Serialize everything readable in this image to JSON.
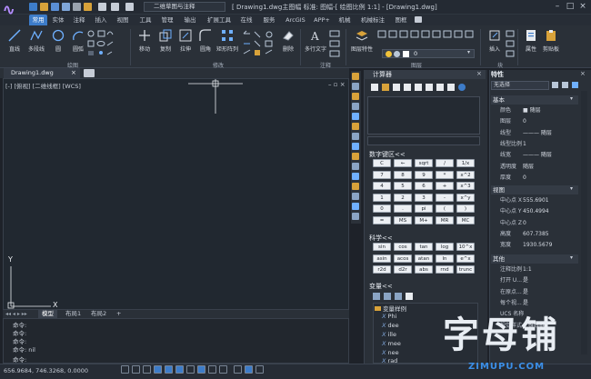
{
  "titlebar": {
    "workspace": "二维草图与注释",
    "title": "[ Drawing1.dwg主图幅  标准: 图幅-[ 绘图比例 1:1] - [Drawing1.dwg]"
  },
  "menu": {
    "tabs": [
      "常用",
      "实体",
      "注释",
      "插入",
      "视图",
      "工具",
      "管理",
      "输出",
      "扩展工具",
      "在线",
      "服务",
      "ArcGIS",
      "APP+",
      "机械",
      "机械标注",
      "图框"
    ]
  },
  "ribbon": {
    "draw": {
      "line": "直线",
      "polyline": "多段线",
      "circle": "圆",
      "arc": "圆弧"
    },
    "modify": {
      "move": "移动",
      "copy": "复制",
      "stretch": "拉伸",
      "fillet": "圆角",
      "array": "矩形阵列",
      "erase": "删除"
    },
    "annotate": {
      "mtext": "多行文字"
    },
    "layer": {
      "props": "图层特性",
      "value": "0"
    },
    "block": {
      "insert": "插入"
    },
    "props": {
      "properties": "属性",
      "clipboard": "剪贴板"
    },
    "groups": {
      "draw": "绘图",
      "modify": "修改",
      "annotate": "注释",
      "layer": "图层",
      "block": "块"
    }
  },
  "document": {
    "tab": "Drawing1.dwg",
    "view_label": "[-] [俯视] [二维线框] [WCS]",
    "axis_x": "X",
    "axis_y": "Y"
  },
  "layout_tabs": [
    "模型",
    "布局1",
    "布局2"
  ],
  "command_lines": [
    "命令:",
    "命令:",
    "命令:",
    "命令: nil",
    "命令:"
  ],
  "status": {
    "coords": "656.9684, 746.3268, 0.0000"
  },
  "calculator": {
    "title": "计算器",
    "numpad_title": "数字键区<<",
    "numpad": [
      [
        "C",
        "←",
        "sqrt",
        "/",
        "1/x"
      ],
      [
        "7",
        "8",
        "9",
        "*",
        "x^2"
      ],
      [
        "4",
        "5",
        "6",
        "+",
        "x^3"
      ],
      [
        "1",
        "2",
        "3",
        "-",
        "x^y"
      ],
      [
        "0",
        ".",
        "pi",
        "(",
        ")"
      ],
      [
        "=",
        "MS",
        "M+",
        "MR",
        "MC"
      ]
    ],
    "sci_title": "科学<<",
    "sci": [
      [
        "sin",
        "cos",
        "tan",
        "log",
        "10^x"
      ],
      [
        "asin",
        "acos",
        "atan",
        "ln",
        "e^x"
      ],
      [
        "r2d",
        "d2r",
        "abs",
        "rnd",
        "trunc"
      ]
    ],
    "vars_title": "变量<<",
    "vars_group": "变量样例",
    "vars": [
      "Phi",
      "dee",
      "ille",
      "mee",
      "nee",
      "rad"
    ]
  },
  "properties": {
    "title": "特性",
    "selection": "无选择",
    "sections": {
      "basic": "基本",
      "view": "视图",
      "other": "其他"
    },
    "basic_rows": [
      {
        "k": "颜色",
        "v": "■ 随层"
      },
      {
        "k": "图层",
        "v": "0"
      },
      {
        "k": "线型",
        "v": "——— 随层"
      },
      {
        "k": "线型比例",
        "v": "1"
      },
      {
        "k": "线宽",
        "v": "——— 随层"
      },
      {
        "k": "透明度",
        "v": "随层"
      },
      {
        "k": "厚度",
        "v": "0"
      }
    ],
    "view_rows": [
      {
        "k": "中心点 X",
        "v": "555.6901"
      },
      {
        "k": "中心点 Y",
        "v": "450.4994"
      },
      {
        "k": "中心点 Z",
        "v": "0"
      },
      {
        "k": "高度",
        "v": "607.7385"
      },
      {
        "k": "宽度",
        "v": "1930.5679"
      }
    ],
    "other_rows": [
      {
        "k": "注释比例",
        "v": "1:1"
      },
      {
        "k": "打开 U...",
        "v": "是"
      },
      {
        "k": "在原点...",
        "v": "是"
      },
      {
        "k": "每个视...",
        "v": "是"
      },
      {
        "k": "UCS 名称",
        "v": ""
      },
      {
        "k": "视觉样式",
        "v": "二维线框"
      }
    ]
  },
  "watermark": {
    "cn": "字母铺",
    "en": "ZIMUPU.COM"
  },
  "colors": {
    "accent": "#3d7cc9",
    "bg": "#1e2229"
  }
}
